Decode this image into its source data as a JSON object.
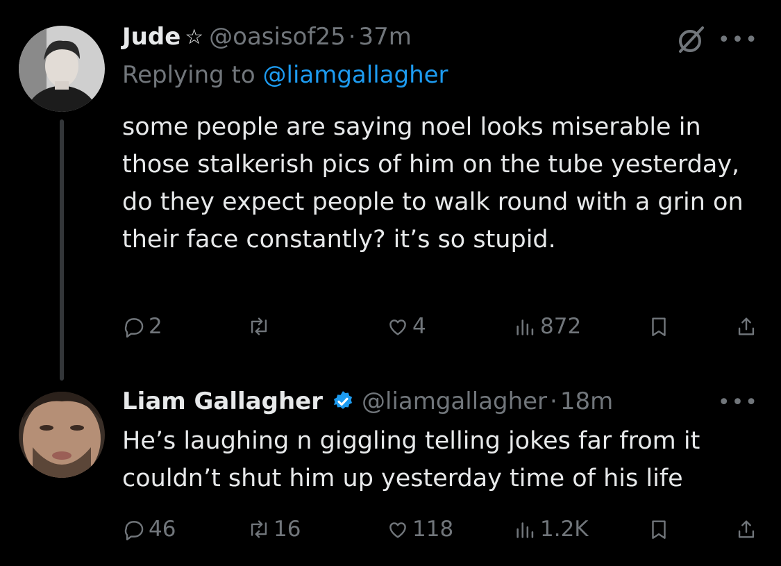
{
  "tweets": [
    {
      "display_name": "Jude",
      "name_badge_icon": "star-outline-icon",
      "handle": "@oasisof25",
      "separator": "·",
      "time": "37m",
      "replying_prefix": "Replying to",
      "replying_to": "@liamgallagher",
      "text": "some people are saying noel looks miserable in those stalkerish pics of him on the tube yesterday, do they expect people to walk round with a grin on their face constantly? it’s so stupid.",
      "stats": {
        "replies": "2",
        "retweets": "",
        "likes": "4",
        "views": "872"
      }
    },
    {
      "display_name": "Liam Gallagher",
      "name_badge_icon": "verified-badge-icon",
      "handle": "@liamgallagher",
      "separator": "·",
      "time": "18m",
      "text": "He’s laughing n giggling telling jokes far from it couldn’t shut him up yesterday time of his life",
      "stats": {
        "replies": "46",
        "retweets": "16",
        "likes": "118",
        "views": "1.2K"
      }
    }
  ],
  "icons": [
    "grok-icon",
    "more-options-icon",
    "reply-icon",
    "retweet-icon",
    "like-icon",
    "views-icon",
    "bookmark-icon",
    "share-icon"
  ],
  "colors": {
    "background": "#000000",
    "text": "#e7e9ea",
    "muted": "#71767b",
    "accent": "#1d9bf0",
    "thread_line": "#333639"
  }
}
